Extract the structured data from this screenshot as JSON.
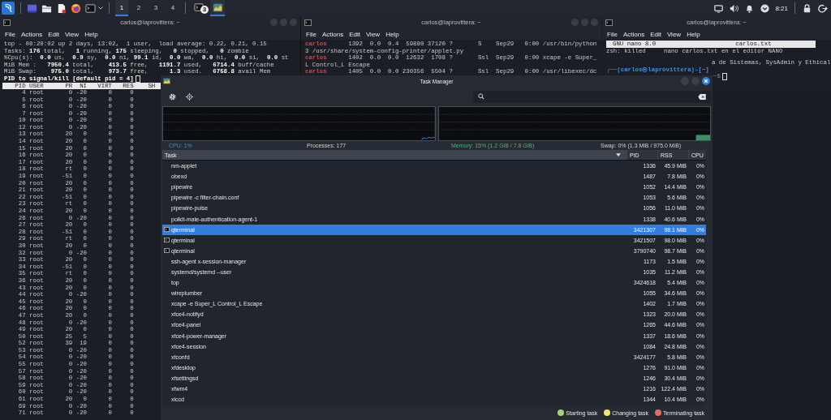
{
  "panel": {
    "workspaces": [
      {
        "label": "1",
        "selected": true
      },
      {
        "label": "2",
        "selected": false
      },
      {
        "label": "3",
        "selected": false
      },
      {
        "label": "4",
        "selected": false
      }
    ],
    "tasks": [
      {
        "kind": "terminal",
        "badge": "3",
        "selected": false
      },
      {
        "kind": "monitor",
        "selected": true
      }
    ],
    "clock": "8:21"
  },
  "left_terminal": {
    "title": "carlos@laprovittera: ~",
    "menu": [
      "File",
      "Actions",
      "Edit",
      "View",
      "Help"
    ],
    "summary": [
      "top - 08:20:02 up 2 days, 13:02,  1 user,  load average: 0.22, 0.21, 0.15",
      "Tasks: **176** total,   **1** running, **175** sleeping,   **0** stopped,   **0** zombie",
      "%Cpu(s):  **0.0** us,  **0.9** sy,  **0.0** ni, **99.1** id,  **0.0** wa,  **0.0** hi,  **0.0** si,  **0.0** st",
      "MiB Mem :   **7950.4** total,    **413.5** free,   **1191.7** used,   **6714.4** buff/cache",
      "MiB Swap:    **975.0** total,    **973.7** free,      **1.3** used.   **6758.8** avail Mem"
    ],
    "prompt": "PID to signal/kill [default pid = 4]",
    "columns": [
      "PID",
      "USER",
      "PR",
      "NI",
      "VIRT",
      "RES",
      "SH"
    ],
    "processes": [
      {
        "pid": "4",
        "user": "root",
        "pr": "0",
        "ni": "-20",
        "virt": "0",
        "res": "0"
      },
      {
        "pid": "5",
        "user": "root",
        "pr": "0",
        "ni": "-20",
        "virt": "0",
        "res": "0"
      },
      {
        "pid": "6",
        "user": "root",
        "pr": "0",
        "ni": "-20",
        "virt": "0",
        "res": "0"
      },
      {
        "pid": "7",
        "user": "root",
        "pr": "0",
        "ni": "-20",
        "virt": "0",
        "res": "0"
      },
      {
        "pid": "10",
        "user": "root",
        "pr": "0",
        "ni": "-20",
        "virt": "0",
        "res": "0"
      },
      {
        "pid": "12",
        "user": "root",
        "pr": "0",
        "ni": "-20",
        "virt": "0",
        "res": "0"
      },
      {
        "pid": "13",
        "user": "root",
        "pr": "20",
        "ni": "0",
        "virt": "0",
        "res": "0"
      },
      {
        "pid": "14",
        "user": "root",
        "pr": "20",
        "ni": "0",
        "virt": "0",
        "res": "0"
      },
      {
        "pid": "15",
        "user": "root",
        "pr": "20",
        "ni": "0",
        "virt": "0",
        "res": "0"
      },
      {
        "pid": "16",
        "user": "root",
        "pr": "20",
        "ni": "0",
        "virt": "0",
        "res": "0"
      },
      {
        "pid": "17",
        "user": "root",
        "pr": "20",
        "ni": "0",
        "virt": "0",
        "res": "0"
      },
      {
        "pid": "18",
        "user": "root",
        "pr": "rt",
        "ni": "0",
        "virt": "0",
        "res": "0"
      },
      {
        "pid": "19",
        "user": "root",
        "pr": "-51",
        "ni": "0",
        "virt": "0",
        "res": "0"
      },
      {
        "pid": "20",
        "user": "root",
        "pr": "20",
        "ni": "0",
        "virt": "0",
        "res": "0"
      },
      {
        "pid": "21",
        "user": "root",
        "pr": "20",
        "ni": "0",
        "virt": "0",
        "res": "0"
      },
      {
        "pid": "22",
        "user": "root",
        "pr": "-51",
        "ni": "0",
        "virt": "0",
        "res": "0"
      },
      {
        "pid": "23",
        "user": "root",
        "pr": "rt",
        "ni": "0",
        "virt": "0",
        "res": "0"
      },
      {
        "pid": "24",
        "user": "root",
        "pr": "20",
        "ni": "0",
        "virt": "0",
        "res": "0"
      },
      {
        "pid": "26",
        "user": "root",
        "pr": "0",
        "ni": "-20",
        "virt": "0",
        "res": "0"
      },
      {
        "pid": "27",
        "user": "root",
        "pr": "20",
        "ni": "0",
        "virt": "0",
        "res": "0"
      },
      {
        "pid": "28",
        "user": "root",
        "pr": "-51",
        "ni": "0",
        "virt": "0",
        "res": "0"
      },
      {
        "pid": "29",
        "user": "root",
        "pr": "rt",
        "ni": "0",
        "virt": "0",
        "res": "0"
      },
      {
        "pid": "30",
        "user": "root",
        "pr": "20",
        "ni": "0",
        "virt": "0",
        "res": "0"
      },
      {
        "pid": "32",
        "user": "root",
        "pr": "0",
        "ni": "-20",
        "virt": "0",
        "res": "0"
      },
      {
        "pid": "33",
        "user": "root",
        "pr": "20",
        "ni": "0",
        "virt": "0",
        "res": "0"
      },
      {
        "pid": "34",
        "user": "root",
        "pr": "-51",
        "ni": "0",
        "virt": "0",
        "res": "0"
      },
      {
        "pid": "35",
        "user": "root",
        "pr": "rt",
        "ni": "0",
        "virt": "0",
        "res": "0"
      },
      {
        "pid": "36",
        "user": "root",
        "pr": "20",
        "ni": "0",
        "virt": "0",
        "res": "0"
      },
      {
        "pid": "43",
        "user": "root",
        "pr": "20",
        "ni": "0",
        "virt": "0",
        "res": "0"
      },
      {
        "pid": "44",
        "user": "root",
        "pr": "0",
        "ni": "-20",
        "virt": "0",
        "res": "0"
      },
      {
        "pid": "45",
        "user": "root",
        "pr": "20",
        "ni": "0",
        "virt": "0",
        "res": "0"
      },
      {
        "pid": "46",
        "user": "root",
        "pr": "20",
        "ni": "0",
        "virt": "0",
        "res": "0"
      },
      {
        "pid": "47",
        "user": "root",
        "pr": "20",
        "ni": "0",
        "virt": "0",
        "res": "0"
      },
      {
        "pid": "48",
        "user": "root",
        "pr": "0",
        "ni": "-20",
        "virt": "0",
        "res": "0"
      },
      {
        "pid": "49",
        "user": "root",
        "pr": "20",
        "ni": "0",
        "virt": "0",
        "res": "0"
      },
      {
        "pid": "50",
        "user": "root",
        "pr": "25",
        "ni": "5",
        "virt": "0",
        "res": "0"
      },
      {
        "pid": "52",
        "user": "root",
        "pr": "39",
        "ni": "19",
        "virt": "0",
        "res": "0"
      },
      {
        "pid": "53",
        "user": "root",
        "pr": "0",
        "ni": "-20",
        "virt": "0",
        "res": "0"
      },
      {
        "pid": "54",
        "user": "root",
        "pr": "0",
        "ni": "-20",
        "virt": "0",
        "res": "0"
      },
      {
        "pid": "55",
        "user": "root",
        "pr": "0",
        "ni": "-20",
        "virt": "0",
        "res": "0"
      },
      {
        "pid": "57",
        "user": "root",
        "pr": "0",
        "ni": "-20",
        "virt": "0",
        "res": "0"
      },
      {
        "pid": "58",
        "user": "root",
        "pr": "0",
        "ni": "-20",
        "virt": "0",
        "res": "0"
      },
      {
        "pid": "59",
        "user": "root",
        "pr": "0",
        "ni": "-20",
        "virt": "0",
        "res": "0"
      },
      {
        "pid": "60",
        "user": "root",
        "pr": "0",
        "ni": "-20",
        "virt": "0",
        "res": "0"
      },
      {
        "pid": "61",
        "user": "root",
        "pr": "20",
        "ni": "0",
        "virt": "0",
        "res": "0"
      },
      {
        "pid": "69",
        "user": "root",
        "pr": "0",
        "ni": "-20",
        "virt": "0",
        "res": "0"
      },
      {
        "pid": "71",
        "user": "root",
        "pr": "0",
        "ni": "-20",
        "virt": "0",
        "res": "0"
      }
    ]
  },
  "middle_terminal": {
    "title": "carlos@laprovittera: ~",
    "menu": [
      "File",
      "Actions",
      "Edit",
      "View",
      "Help"
    ],
    "lines": [
      {
        "user": "carlos",
        "text": "      1392  0.0  0.4  59880 37120 ?       S    Sep29   0:00 /usr/bin/python"
      },
      {
        "text": "3 /usr/share/system-config-printer/applet.py"
      },
      {
        "user": "carlos",
        "text": "      1402  0.0  0.0  12632  1708 ?       Ssl  Sep29   0:00 xcape -e Super_"
      },
      {
        "text": "L Control_L Escape"
      },
      {
        "user": "carlos",
        "text": "      1405  0.0  0.0 230356  5504 ?       Ssl  Sep29   0:00 /usr/libexec/dc"
      }
    ]
  },
  "right_terminal": {
    "title": "carlos@laprovittera: ~",
    "menu": [
      "File",
      "Actions",
      "Edit",
      "View",
      "Help"
    ],
    "nano_bar": {
      "version": "GNU nano 8.0",
      "file": "carlos.txt"
    },
    "lines": [
      {
        "kind": "output",
        "text": "zsh: killed     nano carlos.txt en el editor NANO"
      },
      {
        "kind": "remnant",
        "text": "a de Sistemas, SysAdmin y Ethical"
      },
      {
        "kind": "prompt",
        "text": "┌──(carlos㉿laprovittera)-[~]"
      },
      {
        "kind": "tail",
        "text": "─$"
      }
    ]
  },
  "task_manager": {
    "title": "Task Manager",
    "stats": {
      "cpu": "CPU: 1%",
      "processes": "Processes: 177",
      "memory": "Memory: 15% (1.2 GiB / 7.8 GiB)",
      "swap": "Swap: 0% (1.3 MiB / 975.0 MiB)"
    },
    "columns": [
      {
        "label": "Task",
        "sorted": true
      },
      {
        "label": "PID",
        "sorted": false
      },
      {
        "label": "RSS",
        "sorted": false
      },
      {
        "label": "CPU",
        "sorted": false
      }
    ],
    "rows": [
      {
        "kind": "process",
        "name": "nm-applet",
        "pid": "1336",
        "rss": "45.9 MiB",
        "cpu": "0%",
        "selected": false
      },
      {
        "kind": "process",
        "name": "obexd",
        "pid": "1487",
        "rss": "7.8 MiB",
        "cpu": "0%",
        "selected": false
      },
      {
        "kind": "process",
        "name": "pipewire",
        "pid": "1052",
        "rss": "14.4 MiB",
        "cpu": "0%",
        "selected": false
      },
      {
        "kind": "process",
        "name": "pipewire -c filter-chain.conf",
        "pid": "1053",
        "rss": "5.6 MiB",
        "cpu": "0%",
        "selected": false
      },
      {
        "kind": "process",
        "name": "pipewire-pulse",
        "pid": "1056",
        "rss": "11.0 MiB",
        "cpu": "0%",
        "selected": false
      },
      {
        "kind": "process",
        "name": "polkit-mate-authentication-agent-1",
        "pid": "1338",
        "rss": "40.6 MiB",
        "cpu": "0%",
        "selected": false
      },
      {
        "kind": "window",
        "name": "qterminal",
        "pid": "3421307",
        "rss": "98.1 MiB",
        "cpu": "0%",
        "selected": true
      },
      {
        "kind": "window",
        "name": "qterminal",
        "pid": "3421507",
        "rss": "98.0 MiB",
        "cpu": "0%",
        "selected": false
      },
      {
        "kind": "window",
        "name": "qterminal",
        "pid": "3790740",
        "rss": "98.7 MiB",
        "cpu": "0%",
        "selected": false
      },
      {
        "kind": "process",
        "name": "ssh-agent x-session-manager",
        "pid": "1173",
        "rss": "1.5 MiB",
        "cpu": "0%",
        "selected": false
      },
      {
        "kind": "process",
        "name": "systemd/systemd --user",
        "pid": "1035",
        "rss": "11.2 MiB",
        "cpu": "0%",
        "selected": false
      },
      {
        "kind": "process",
        "name": "top",
        "pid": "3424618",
        "rss": "5.4 MiB",
        "cpu": "0%",
        "selected": false
      },
      {
        "kind": "process",
        "name": "wireplumber",
        "pid": "1055",
        "rss": "34.6 MiB",
        "cpu": "0%",
        "selected": false
      },
      {
        "kind": "process",
        "name": "xcape -e Super_L Control_L Escape",
        "pid": "1402",
        "rss": "1.7 MiB",
        "cpu": "0%",
        "selected": false
      },
      {
        "kind": "process",
        "name": "xfce4-notifyd",
        "pid": "1323",
        "rss": "20.0 MiB",
        "cpu": "0%",
        "selected": false
      },
      {
        "kind": "process",
        "name": "xfce4-panel",
        "pid": "1265",
        "rss": "44.6 MiB",
        "cpu": "0%",
        "selected": false
      },
      {
        "kind": "process",
        "name": "xfce4-power-manager",
        "pid": "1337",
        "rss": "18.6 MiB",
        "cpu": "0%",
        "selected": false
      },
      {
        "kind": "process",
        "name": "xfce4-session",
        "pid": "1084",
        "rss": "24.8 MiB",
        "cpu": "0%",
        "selected": false
      },
      {
        "kind": "process",
        "name": "xfconfd",
        "pid": "3424177",
        "rss": "5.8 MiB",
        "cpu": "0%",
        "selected": false
      },
      {
        "kind": "process",
        "name": "xfdesktop",
        "pid": "1276",
        "rss": "91.0 MiB",
        "cpu": "0%",
        "selected": false
      },
      {
        "kind": "process",
        "name": "xfsettingsd",
        "pid": "1246",
        "rss": "30.4 MiB",
        "cpu": "0%",
        "selected": false
      },
      {
        "kind": "process",
        "name": "xfwm4",
        "pid": "1216",
        "rss": "122.4 MiB",
        "cpu": "0%",
        "selected": false
      },
      {
        "kind": "process",
        "name": "xiccd",
        "pid": "1344",
        "rss": "10.4 MiB",
        "cpu": "0%",
        "selected": false
      }
    ],
    "legend": [
      {
        "label": "Starting task",
        "color": "#a3d477"
      },
      {
        "label": "Changing task",
        "color": "#f1e46c"
      },
      {
        "label": "Terminating task",
        "color": "#e36a6a"
      }
    ]
  }
}
